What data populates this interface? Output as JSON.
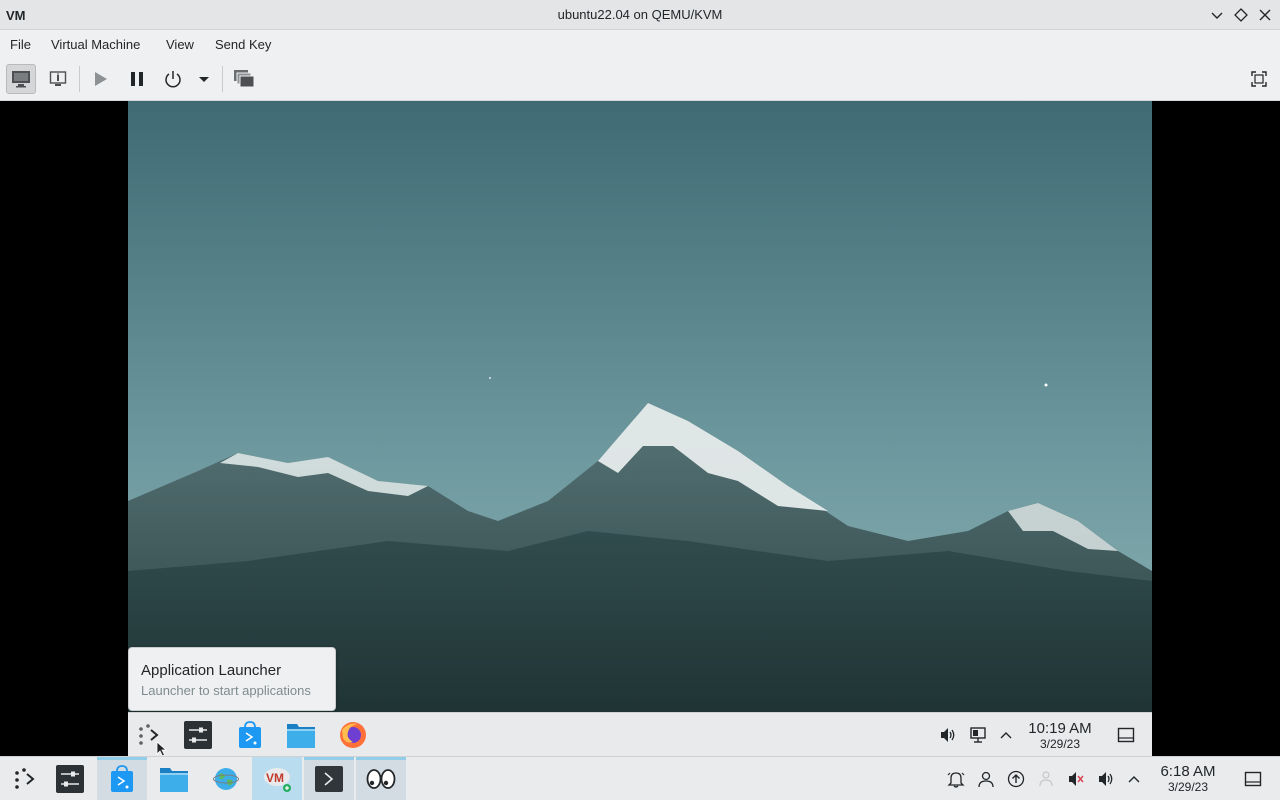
{
  "window": {
    "app_logo": "VM",
    "title": "ubuntu22.04 on QEMU/KVM",
    "controls": [
      "chevron-down-icon",
      "diamond-icon",
      "close-icon"
    ]
  },
  "menubar": {
    "items": [
      "File",
      "Virtual Machine",
      "View",
      "Send Key"
    ]
  },
  "toolbar": {
    "buttons": [
      "console-icon",
      "details-icon",
      "run-icon",
      "pause-icon",
      "power-icon",
      "dropdown-arrow-icon",
      "snapshots-icon",
      "fullscreen-icon"
    ],
    "active": "console-icon"
  },
  "guest": {
    "tooltip": {
      "title": "Application Launcher",
      "subtitle": "Launcher to start applications"
    },
    "panel": {
      "launchers": [
        "app-launcher-icon",
        "system-settings-icon",
        "discover-icon",
        "file-manager-icon",
        "firefox-icon"
      ],
      "tray": [
        "volume-icon",
        "network-icon",
        "expand-tray-icon"
      ],
      "clock": {
        "time": "10:19 AM",
        "date": "3/29/23"
      }
    }
  },
  "taskbar": {
    "tasks": [
      "app-launcher-icon",
      "system-settings-icon",
      "discover-icon",
      "file-manager-icon",
      "browser-icon",
      "virt-manager-icon",
      "terminal-icon",
      "eyes-icon"
    ],
    "tray": [
      "notifications-icon",
      "user-icon",
      "updates-icon",
      "accessibility-icon",
      "mic-muted-icon",
      "volume-icon",
      "expand-tray-icon"
    ],
    "clock": {
      "time": "6:18 AM",
      "date": "3/29/23"
    }
  },
  "colors": {
    "sky_top": "#3f6a74",
    "sky_bottom": "#8cb3b3",
    "mountain": "#2f4a4c",
    "accent": "#93cee9"
  }
}
